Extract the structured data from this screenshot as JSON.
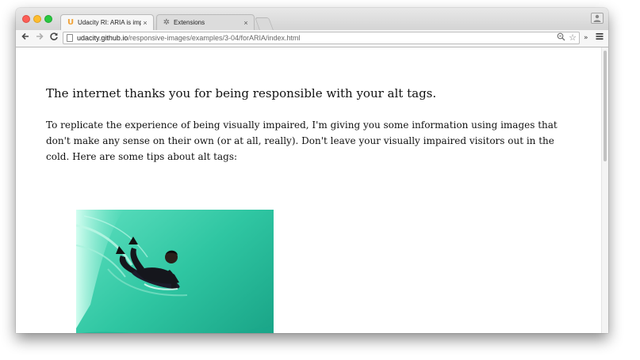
{
  "browser": {
    "tabs": [
      {
        "label": "Udacity RI: ARIA is importa",
        "icon": "udacity-u-icon",
        "active": true
      },
      {
        "label": "Extensions",
        "icon": "puzzle-piece-icon",
        "active": false
      }
    ],
    "tab_close_glyph": "×",
    "favicon_glyph": "U",
    "url_host": "udacity.github.io",
    "url_path": "/responsive-images/examples/3-04/forARIA/index.html"
  },
  "page": {
    "heading": "The internet thanks you for being responsible with your alt tags.",
    "paragraph": "To replicate the experience of being visually impaired, I'm giving you some information using images that don't make any sense on their own (or at all, really). Don't leave your visually impaired visitors out in the cold. Here are some tips about alt tags:",
    "image": "bodyboarder-riding-green-wave"
  },
  "colors": {
    "wave_light": "#3fd2b0",
    "wave_dark": "#0e8f76",
    "udacity_orange": "#f1a238"
  }
}
